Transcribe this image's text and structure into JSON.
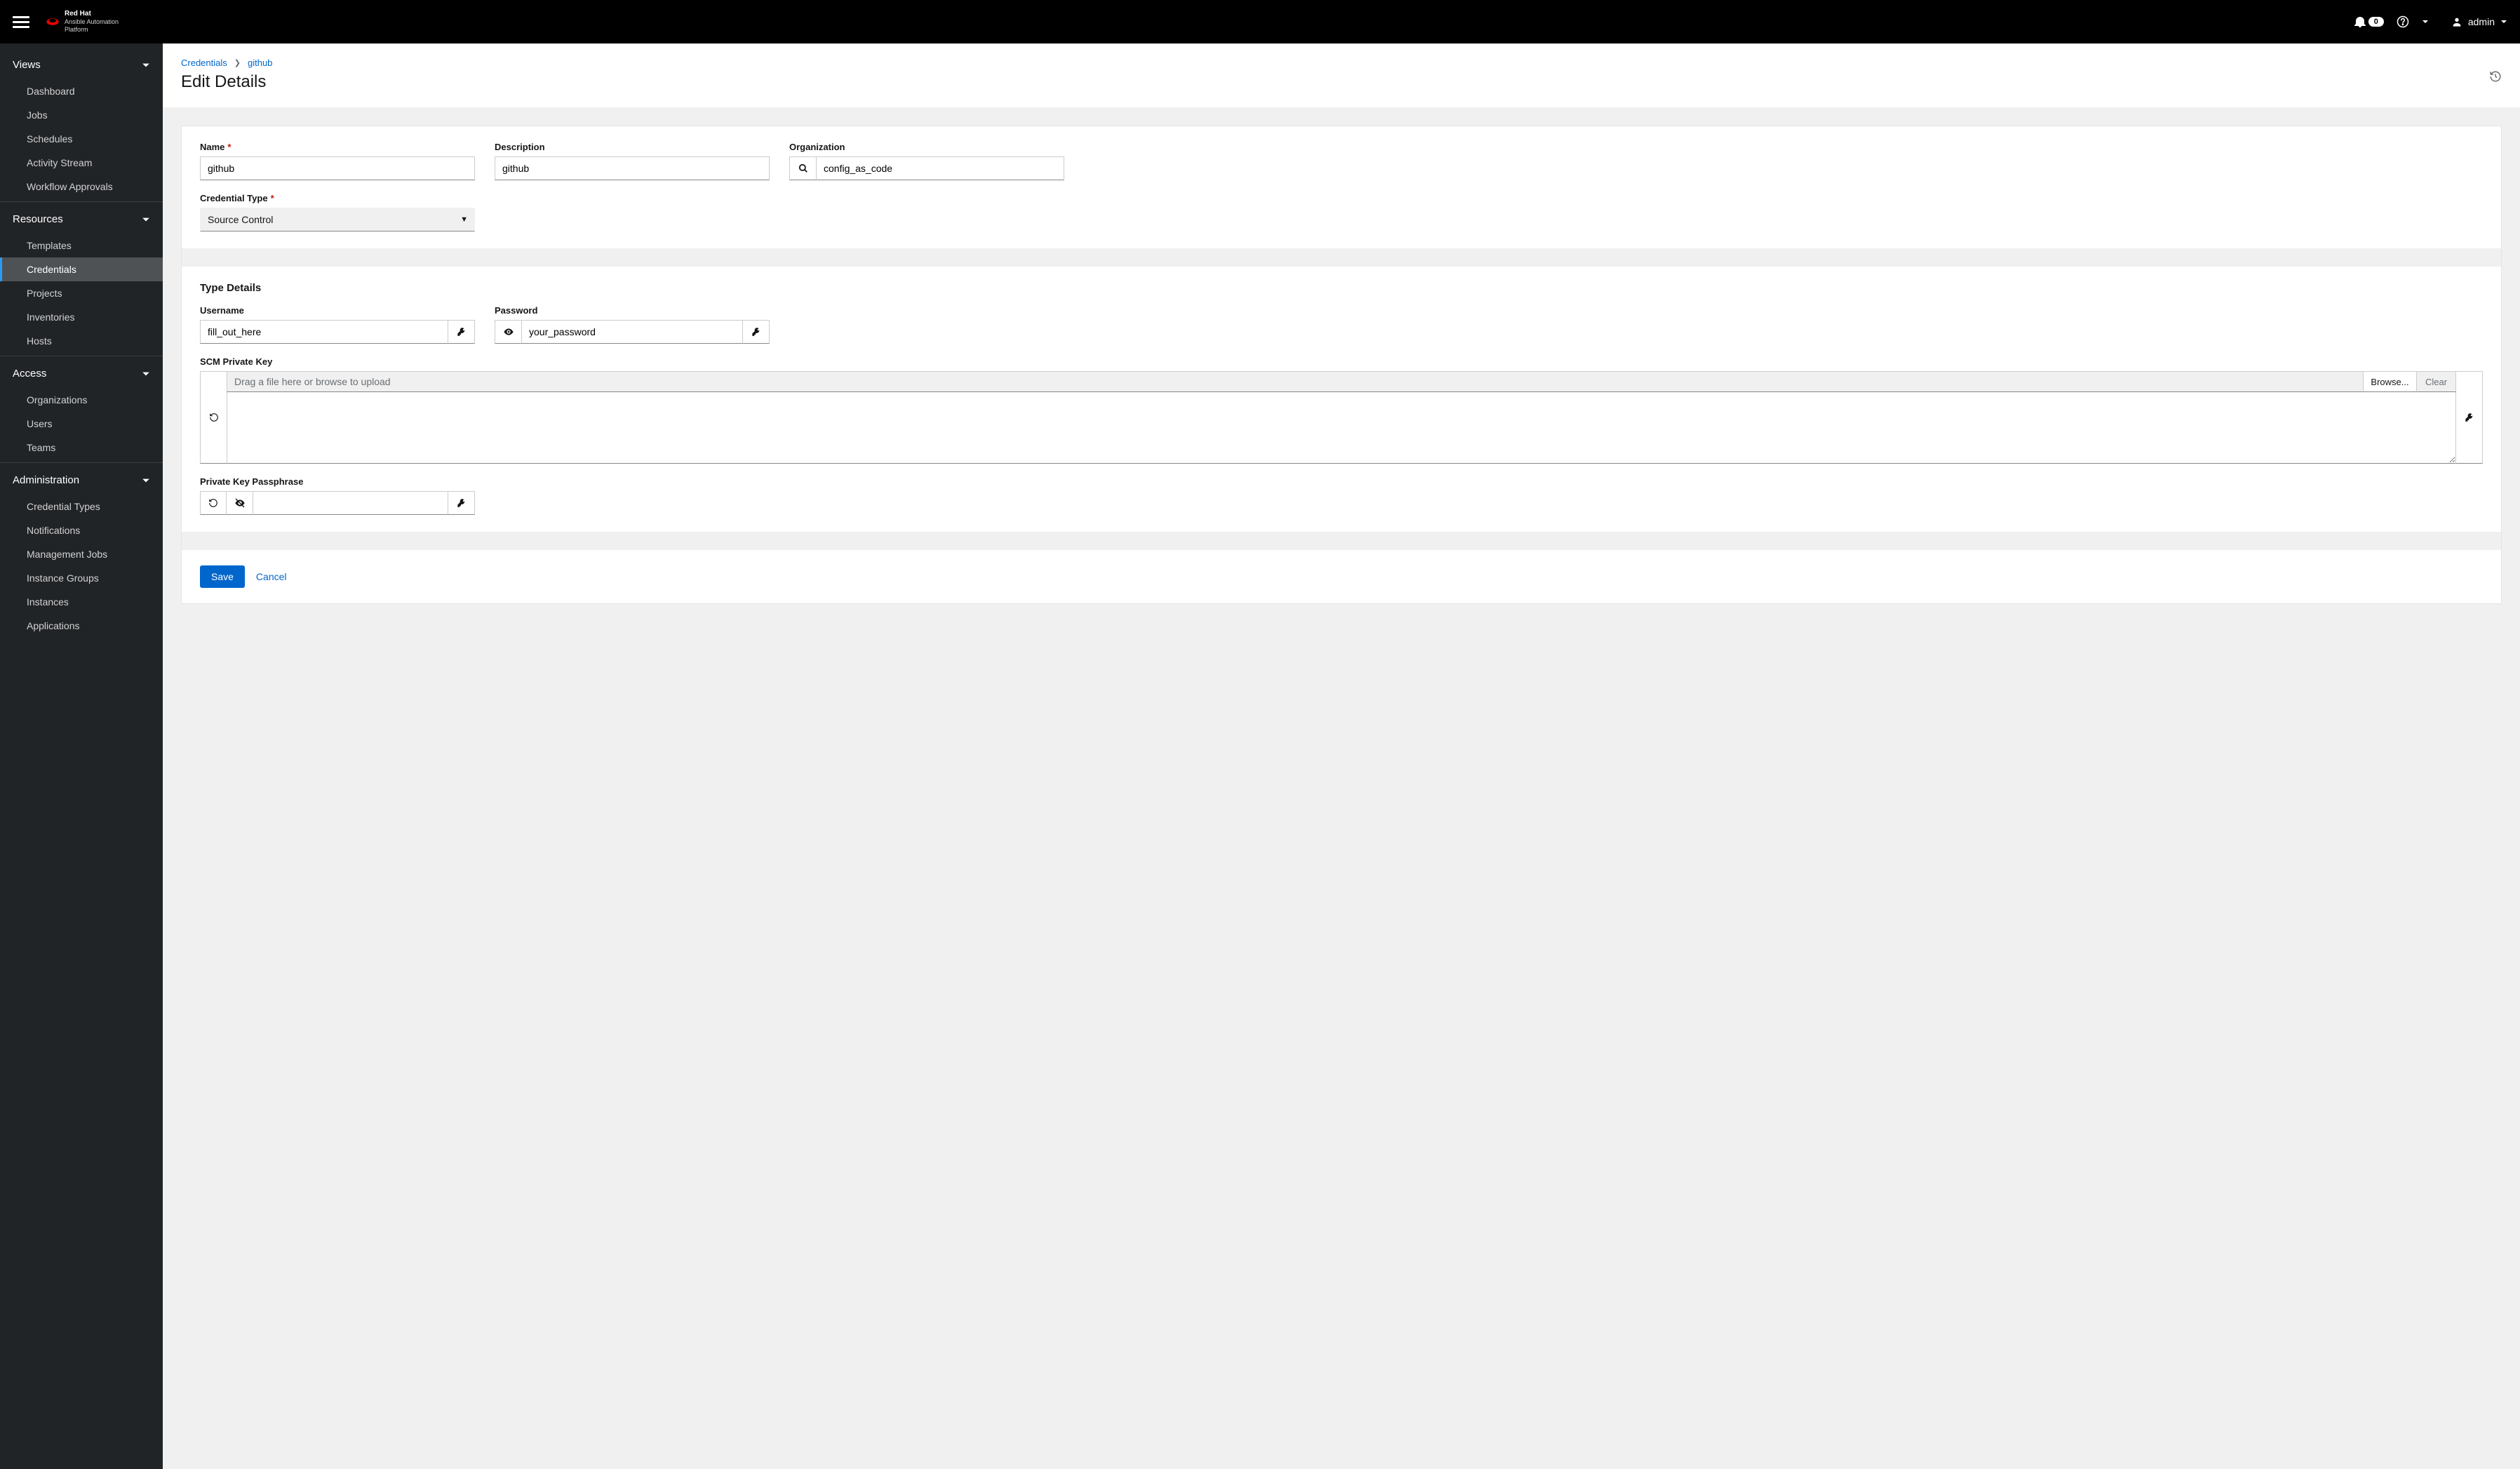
{
  "brand": {
    "name": "Red Hat",
    "product1": "Ansible Automation",
    "product2": "Platform"
  },
  "header": {
    "notif_count": "0",
    "user": "admin"
  },
  "sidebar": {
    "sections": [
      {
        "title": "Views",
        "items": [
          "Dashboard",
          "Jobs",
          "Schedules",
          "Activity Stream",
          "Workflow Approvals"
        ]
      },
      {
        "title": "Resources",
        "items": [
          "Templates",
          "Credentials",
          "Projects",
          "Inventories",
          "Hosts"
        ],
        "active": "Credentials"
      },
      {
        "title": "Access",
        "items": [
          "Organizations",
          "Users",
          "Teams"
        ]
      },
      {
        "title": "Administration",
        "items": [
          "Credential Types",
          "Notifications",
          "Management Jobs",
          "Instance Groups",
          "Instances",
          "Applications"
        ]
      }
    ]
  },
  "breadcrumb": {
    "root": "Credentials",
    "leaf": "github"
  },
  "page": {
    "title": "Edit Details"
  },
  "form": {
    "name": {
      "label": "Name",
      "value": "github"
    },
    "description": {
      "label": "Description",
      "value": "github"
    },
    "organization": {
      "label": "Organization",
      "value": "config_as_code"
    },
    "credential_type": {
      "label": "Credential Type",
      "value": "Source Control"
    },
    "type_details_title": "Type Details",
    "username": {
      "label": "Username",
      "value": "fill_out_here"
    },
    "password": {
      "label": "Password",
      "value": "your_password"
    },
    "scm_key": {
      "label": "SCM Private Key",
      "placeholder": "Drag a file here or browse to upload",
      "browse": "Browse...",
      "clear": "Clear"
    },
    "passphrase": {
      "label": "Private Key Passphrase",
      "value": ""
    },
    "save": "Save",
    "cancel": "Cancel"
  }
}
